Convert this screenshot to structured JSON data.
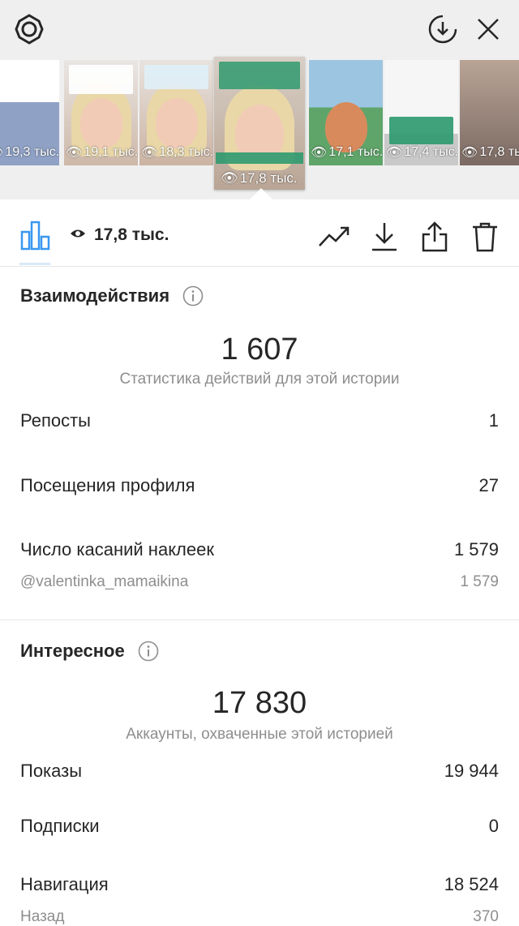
{
  "header": {
    "icons": [
      "gear-icon",
      "download-circle-icon",
      "close-icon"
    ]
  },
  "stories": [
    {
      "views": "19,3 тыс."
    },
    {
      "views": "19,1 тыс."
    },
    {
      "views": "18,3 тыс."
    },
    {
      "views": "17,8 тыс.",
      "selected": true,
      "handle": "@valentinka_mamaikina"
    },
    {
      "views": "17,1 тыс."
    },
    {
      "views": "17,4 тыс."
    },
    {
      "views": "17,8 тыс."
    }
  ],
  "toolbar": {
    "views_value": "17,8 тыс.",
    "icons": [
      "bar-chart-icon",
      "eye-icon",
      "trend-icon",
      "download-icon",
      "share-icon",
      "trash-icon"
    ]
  },
  "interactions": {
    "title": "Взаимодействия",
    "total": "1 607",
    "subtitle": "Статистика действий для этой истории",
    "rows": [
      {
        "label": "Репосты",
        "value": "1"
      },
      {
        "label": "Посещения профиля",
        "value": "27"
      },
      {
        "label": "Число касаний наклеек",
        "value": "1 579"
      }
    ],
    "sticker_row": {
      "label": "@valentinka_mamaikina",
      "value": "1 579"
    }
  },
  "discovery": {
    "title": "Интересное",
    "total": "17 830",
    "subtitle": "Аккаунты, охваченные этой историей",
    "rows": [
      {
        "label": "Показы",
        "value": "19 944"
      },
      {
        "label": "Подписки",
        "value": "0"
      },
      {
        "label": "Навигация",
        "value": "18 524"
      }
    ],
    "back_row": {
      "label": "Назад",
      "value": "370"
    }
  },
  "colors": {
    "accent_blue": "#3897f0",
    "text": "#262626",
    "muted": "#8e8e8e",
    "top_bg": "#efefef"
  }
}
